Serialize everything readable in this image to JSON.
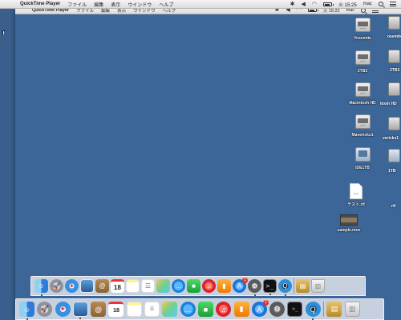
{
  "outer_menubar": {
    "apple": "",
    "items": [
      "QuickTime Player",
      "ファイル",
      "編集",
      "表示",
      "ウインドウ",
      "ヘルプ"
    ],
    "user": "mac",
    "clock": "火 15:25"
  },
  "inner_menubar": {
    "apple": "",
    "items": [
      "QuickTime Player",
      "ファイル",
      "編集",
      "表示",
      "ウインドウ",
      "ヘルプ"
    ],
    "user": "mac",
    "clock": "火 15:22"
  },
  "desktop": {
    "icons": [
      {
        "label": "Yosemite",
        "kind": "internal-drive"
      },
      {
        "label": "2TB3",
        "kind": "internal-drive"
      },
      {
        "label": "Macintosh HD",
        "kind": "internal-drive"
      },
      {
        "label": "Mavericks1",
        "kind": "internal-drive"
      },
      {
        "label": "IDE1TB",
        "kind": "external-drive"
      },
      {
        "label": "テスト.rtf",
        "kind": "document",
        "ext": "RTF"
      },
      {
        "label": "sample.mov",
        "kind": "movie"
      }
    ],
    "outer_partial_labels": [
      "osemite",
      "2TB3",
      "itosh HD",
      "vericks1",
      "1TB",
      "rtf"
    ]
  },
  "dock_apps": [
    {
      "name": "Finder",
      "icon": "finder-icon",
      "glyph": "☺"
    },
    {
      "name": "Launchpad",
      "icon": "launchpad-icon",
      "glyph": "🚀"
    },
    {
      "name": "Safari",
      "icon": "safari-icon",
      "glyph": "✦"
    },
    {
      "name": "Preview",
      "icon": "preview-icon",
      "glyph": ""
    },
    {
      "name": "Contacts",
      "icon": "contacts-icon",
      "glyph": "@"
    },
    {
      "name": "Calendar",
      "icon": "calendar-icon",
      "glyph": "18"
    },
    {
      "name": "Notes",
      "icon": "notes-icon",
      "glyph": ""
    },
    {
      "name": "Reminders",
      "icon": "reminders-icon",
      "glyph": "☰"
    },
    {
      "name": "Photos",
      "icon": "photos-icon",
      "glyph": ""
    },
    {
      "name": "Messages",
      "icon": "messages-icon",
      "glyph": "…"
    },
    {
      "name": "FaceTime",
      "icon": "facetime-icon",
      "glyph": "■"
    },
    {
      "name": "iTunes",
      "icon": "music-icon",
      "glyph": "♫"
    },
    {
      "name": "iBooks",
      "icon": "books-icon",
      "glyph": "▮"
    },
    {
      "name": "App Store",
      "icon": "appstore-icon",
      "glyph": "A",
      "badge": "1"
    },
    {
      "name": "System Preferences",
      "icon": "prefs-icon",
      "glyph": "⚙"
    },
    {
      "name": "Terminal",
      "icon": "terminal-icon",
      "glyph": ">_"
    },
    {
      "name": "QuickTime Player",
      "icon": "quicktime-icon",
      "glyph": "Q"
    }
  ],
  "dock_stacks": [
    {
      "name": "Downloads",
      "icon": "downloads-icon",
      "glyph": "▤"
    },
    {
      "name": "Trash",
      "icon": "trash-icon",
      "glyph": "▥"
    }
  ],
  "colors": {
    "desktop": "#3c6598",
    "menubar": "#e8e8e8",
    "dock": "#e4e8ee",
    "badge": "#e0302a"
  }
}
